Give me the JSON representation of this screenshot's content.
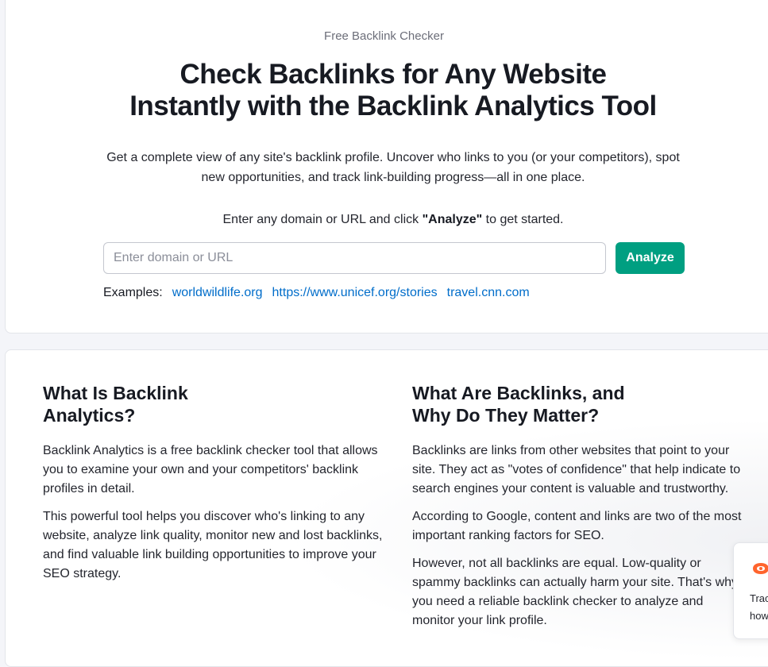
{
  "hero": {
    "eyebrow": "Free Backlink Checker",
    "headline_line1": "Check Backlinks for Any Website",
    "headline_line2": "Instantly with the Backlink Analytics Tool",
    "lede": "Get a complete view of any site's backlink profile. Uncover who links to you (or your competitors), spot new opportunities, and track link-building progress—all in one place.",
    "instruction_before": "Enter any domain or URL and click ",
    "instruction_bold": "\"Analyze\"",
    "instruction_after": " to get started.",
    "search_placeholder": "Enter domain or URL",
    "analyze_label": "Analyze",
    "examples_label": "Examples:",
    "examples": [
      "worldwildlife.org",
      "https://www.unicef.org/stories",
      "travel.cnn.com"
    ]
  },
  "info": {
    "left": {
      "heading": "What Is Backlink\nAnalytics?",
      "paragraphs": [
        "Backlink Analytics is a free backlink checker tool that allows you to examine your own and your competitors' backlink profiles in detail.",
        "This powerful tool helps you discover who's linking to any website, analyze link quality, monitor new and lost backlinks, and find valuable link building opportunities to improve your SEO strategy."
      ]
    },
    "right": {
      "heading": "What Are Backlinks, and\nWhy Do They Matter?",
      "paragraphs": [
        "Backlinks are links from other websites that point to your site. They act as \"votes of confidence\" that help indicate to search engines your content is valuable and trustworthy.",
        "According to Google, content and links are two of the most important ranking factors for SEO.",
        "However, not all backlinks are equal. Low-quality or spammy backlinks can actually harm your site. That's why you need a reliable backlink checker to analyze and monitor your link profile."
      ]
    }
  },
  "chat_widget": {
    "icon": "semrush-logo-icon",
    "line1": "Trac",
    "line2": "how"
  },
  "colors": {
    "accent": "#009f81",
    "link": "#006dca"
  }
}
